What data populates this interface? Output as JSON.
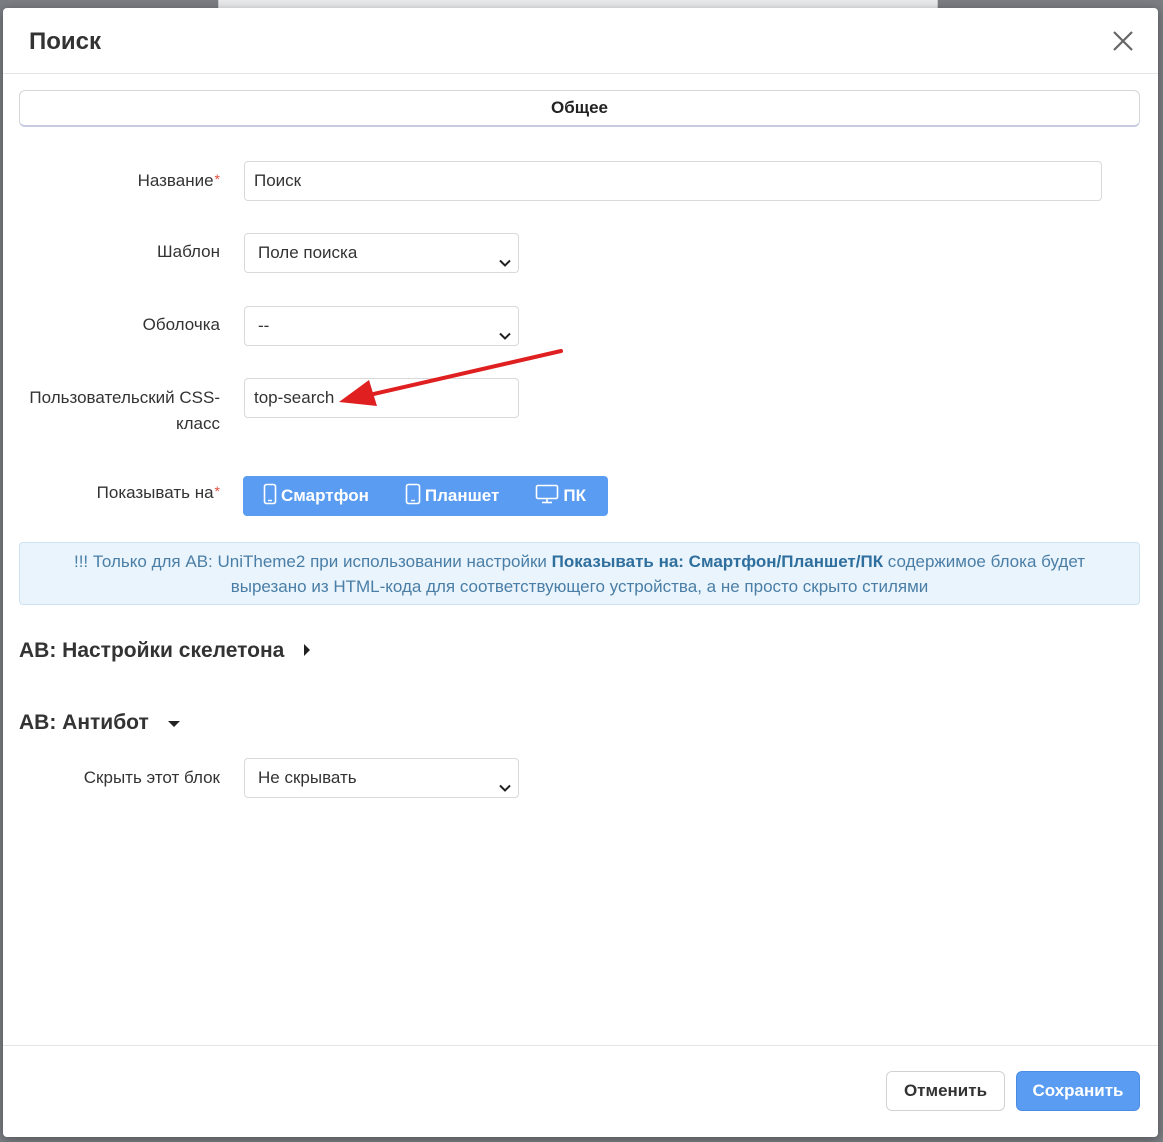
{
  "modal": {
    "title": "Поиск"
  },
  "tabs": [
    {
      "label": "Общее"
    }
  ],
  "form": {
    "name": {
      "label": "Название",
      "value": "Поиск"
    },
    "template": {
      "label": "Шаблон",
      "value": "Поле поиска"
    },
    "wrapper": {
      "label": "Оболочка",
      "value": "--"
    },
    "css_class": {
      "label_line1": "Пользовательский CSS-",
      "label_line2": "класс",
      "value": "top-search"
    },
    "show_on": {
      "label": "Показывать на",
      "options": [
        {
          "label": "Смартфон",
          "icon": "smartphone-icon"
        },
        {
          "label": "Планшет",
          "icon": "tablet-icon"
        },
        {
          "label": "ПК",
          "icon": "desktop-icon"
        }
      ]
    },
    "required_mark": "*"
  },
  "notice": {
    "line1_pre": "!!! Только для AB: UniTheme2 при использовании настройки ",
    "line1_strong": "Показывать на: Смартфон/Планшет/ПК",
    "line1_post": " содержимое блока будет",
    "line2": "вырезано из HTML-кода для соответствующего устройства, а не просто скрыто стилями"
  },
  "sections": {
    "skeleton": {
      "title": "AB: Настройки скелетона",
      "state": "collapsed"
    },
    "antibot": {
      "title": "AB: Антибот",
      "state": "expanded"
    }
  },
  "antibot": {
    "hide_label": "Скрыть этот блок",
    "hide_value": "Не скрывать"
  },
  "footer": {
    "cancel_label": "Отменить",
    "save_label": "Сохранить"
  },
  "colors": {
    "accent": "#5a9cf1",
    "required": "#e74c3c",
    "notice_bg": "#eaf4fc",
    "annotation_arrow": "#e02020"
  }
}
